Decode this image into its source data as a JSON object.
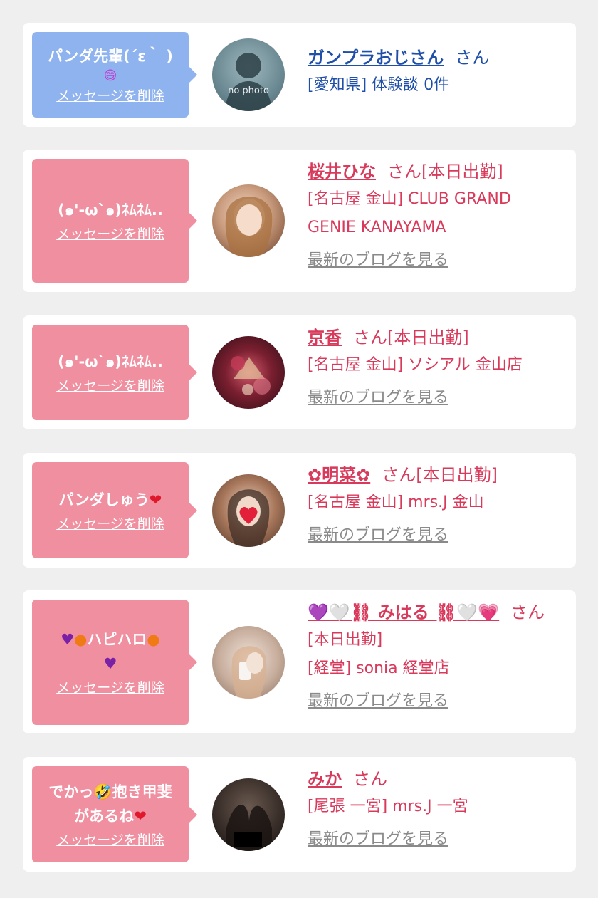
{
  "colors": {
    "background": "#efefef",
    "card": "#ffffff",
    "bubble_blue": "#8fb3ee",
    "bubble_pink": "#f08fa0",
    "name_pink": "#d83a5b",
    "name_blue": "#1f4fa8",
    "blog_link": "#8a8a8a"
  },
  "cards": [
    {
      "bubble_message_1": "パンダ先輩(´ε｀ )",
      "bubble_message_2": "😄",
      "delete_label": "メッセージを削除",
      "avatar_caption": "no photo",
      "name": "ガンプラおじさん",
      "honorific": "さん",
      "detail_1": "[愛知県] 体験談 0件"
    },
    {
      "bubble_message_1": "(๑'-ωˋ๑)ﾈﾑﾈﾑ..",
      "delete_label": "メッセージを削除",
      "name": "桜井ひな",
      "honorific": "さん[本日出勤]",
      "detail_1": "[名古屋 金山] CLUB GRAND",
      "detail_2": "GENIE KANAYAMA",
      "blog_label": "最新のブログを見る"
    },
    {
      "bubble_message_1": "(๑'-ωˋ๑)ﾈﾑﾈﾑ..",
      "delete_label": "メッセージを削除",
      "name": "京香",
      "honorific": "さん[本日出勤]",
      "detail_1": "[名古屋 金山] ソシアル 金山店",
      "blog_label": "最新のブログを見る"
    },
    {
      "bubble_message_1": "パンダしゅう",
      "bubble_emoji": "❤",
      "delete_label": "メッセージを削除",
      "name": "✿明菜✿",
      "honorific": "さん[本日出勤]",
      "detail_1": "[名古屋 金山] mrs.J 金山",
      "blog_label": "最新のブログを見る"
    },
    {
      "bubble_message_1": "ハピハロ",
      "delete_label": "メッセージを削除",
      "name": "💜🤍⛓ みはる ⛓🤍💗",
      "honorific": "さん",
      "detail_1": "[本日出勤]",
      "detail_2": "[経堂] sonia 経堂店",
      "blog_label": "最新のブログを見る"
    },
    {
      "bubble_message_1": "でかっ🤣抱き甲斐",
      "bubble_message_2": "があるね",
      "bubble_emoji": "❤",
      "delete_label": "メッセージを削除",
      "name": "みか",
      "honorific": "さん",
      "detail_1": "[尾張 一宮] mrs.J 一宮",
      "blog_label": "最新のブログを見る"
    }
  ]
}
